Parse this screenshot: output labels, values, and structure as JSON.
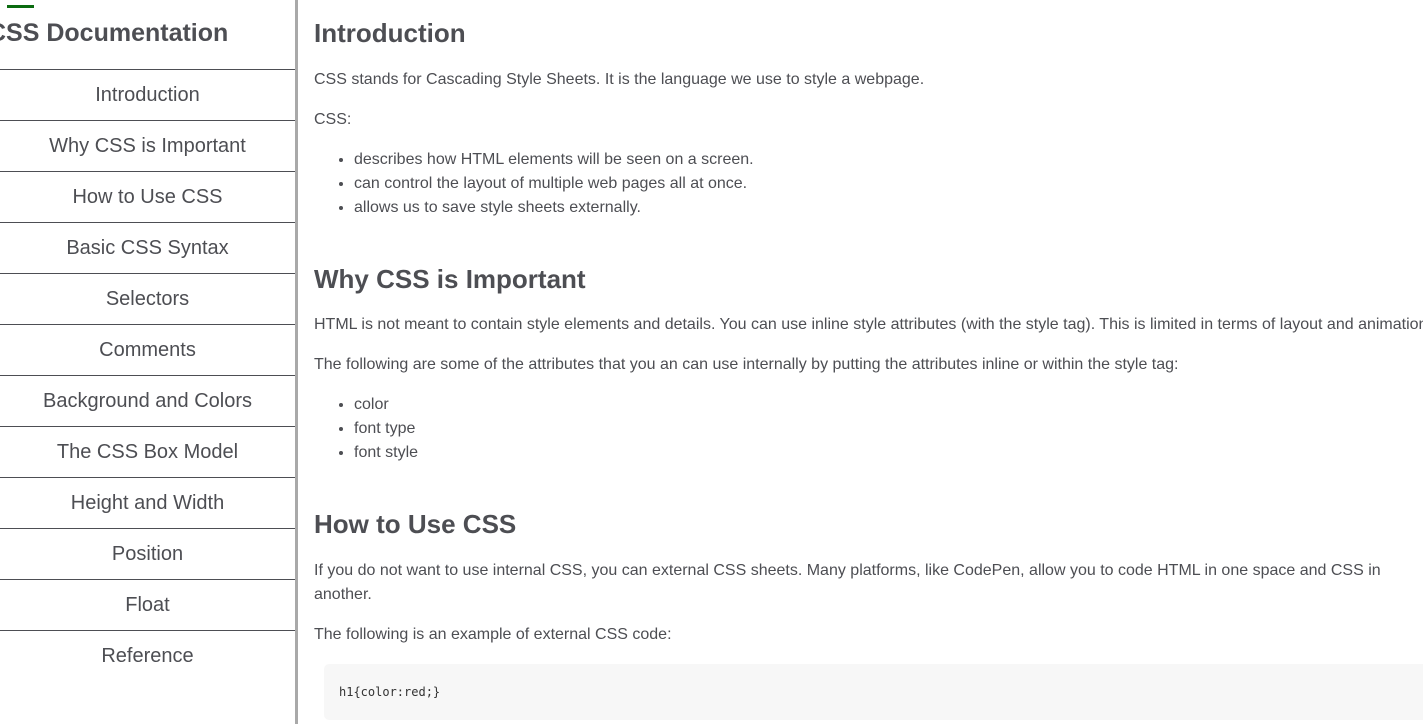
{
  "navbar": {
    "header": "CSS Documentation",
    "links": [
      {
        "label": "Introduction"
      },
      {
        "label": "Why CSS is Important"
      },
      {
        "label": "How to Use CSS"
      },
      {
        "label": "Basic CSS Syntax"
      },
      {
        "label": "Selectors"
      },
      {
        "label": "Comments"
      },
      {
        "label": "Background and Colors"
      },
      {
        "label": "The CSS Box Model"
      },
      {
        "label": "Height and Width"
      },
      {
        "label": "Position"
      },
      {
        "label": "Float"
      },
      {
        "label": "Reference"
      }
    ]
  },
  "main": {
    "sections": [
      {
        "title": "Introduction",
        "paragraphs": [
          "CSS stands for Cascading Style Sheets. It is the language we use to style a webpage.",
          "CSS:"
        ],
        "list": [
          "describes how HTML elements will be seen on a screen.",
          "can control the layout of multiple web pages all at once.",
          "allows us to save style sheets externally."
        ]
      },
      {
        "title": "Why CSS is Important",
        "paragraphs": [
          "HTML is not meant to contain style elements and details. You can use inline style attributes (with the style tag). This is limited in terms of layout and animations",
          "The following are some of the attributes that you an can use internally by putting the attributes inline or within the style tag:"
        ],
        "list": [
          "color",
          "font type",
          "font style"
        ]
      },
      {
        "title": "How to Use CSS",
        "paragraphs": [
          "If you do not want to use internal CSS, you can external CSS sheets. Many platforms, like CodePen, allow you to code HTML in one space and CSS in another.",
          "The following is an example of external CSS code:"
        ],
        "code": "h1{color:red;}"
      }
    ]
  },
  "colors": {
    "text": "#4d4e53",
    "accent": "#0b6b10",
    "divider": "#a9a9a9",
    "code_bg": "#f7f7f7"
  }
}
